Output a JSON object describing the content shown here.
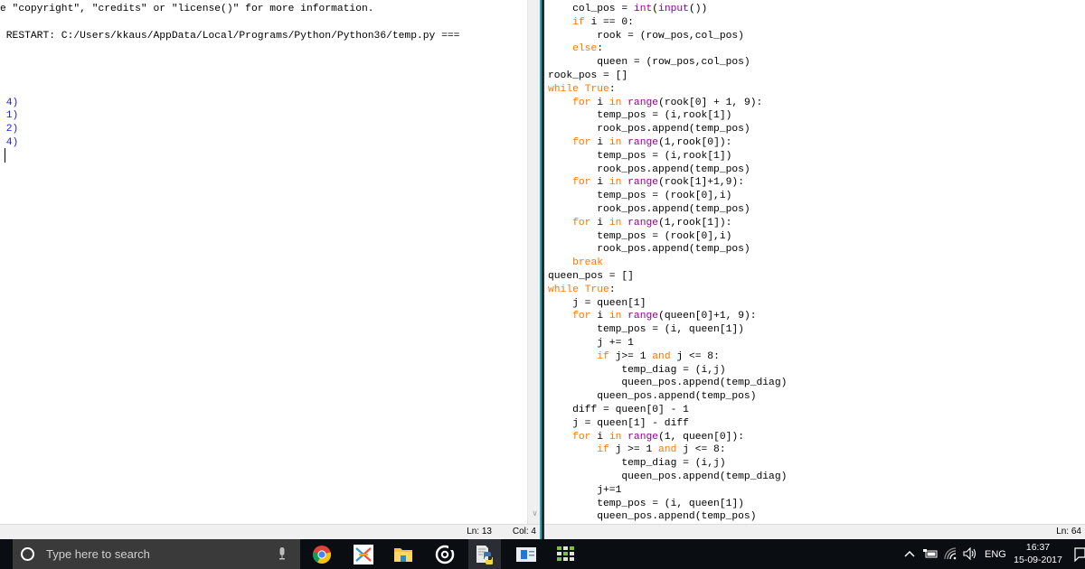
{
  "shell": {
    "lines": [
      {
        "text": "e \"copyright\", \"credits\" or \"license()\" for more information.",
        "type": "normal"
      },
      {
        "text": "",
        "type": "normal"
      },
      {
        "text": " RESTART: C:/Users/kkaus/AppData/Local/Programs/Python/Python36/temp.py ===",
        "type": "normal"
      },
      {
        "text": "",
        "type": "normal"
      },
      {
        "text": "",
        "type": "normal"
      },
      {
        "text": "",
        "type": "normal"
      },
      {
        "text": "",
        "type": "normal"
      },
      {
        "text": " 4)",
        "type": "out"
      },
      {
        "text": " 1)",
        "type": "out"
      },
      {
        "text": " 2)",
        "type": "out"
      },
      {
        "text": " 4)",
        "type": "out"
      }
    ],
    "status": {
      "ln": "Ln: 13",
      "col": "Col: 4"
    }
  },
  "editor": {
    "lines": [
      [
        [
          "    col_pos = ",
          ""
        ],
        [
          "int",
          "bi"
        ],
        [
          "(",
          ""
        ],
        [
          "input",
          "bi"
        ],
        [
          "())",
          ""
        ]
      ],
      [
        [
          "    ",
          ""
        ],
        [
          "if",
          "kw"
        ],
        [
          " i == 0:",
          ""
        ]
      ],
      [
        [
          "        rook = (row_pos,col_pos)",
          ""
        ]
      ],
      [
        [
          "    ",
          ""
        ],
        [
          "else",
          "kw"
        ],
        [
          ":",
          ""
        ]
      ],
      [
        [
          "        queen = (row_pos,col_pos)",
          ""
        ]
      ],
      [
        [
          "rook_pos = []",
          ""
        ]
      ],
      [
        [
          "while",
          "kw"
        ],
        [
          " ",
          ""
        ],
        [
          "True",
          "kw"
        ],
        [
          ":",
          ""
        ]
      ],
      [
        [
          "    ",
          ""
        ],
        [
          "for",
          "kw"
        ],
        [
          " i ",
          ""
        ],
        [
          "in",
          "kw"
        ],
        [
          " ",
          ""
        ],
        [
          "range",
          "bi"
        ],
        [
          "(rook[0] + 1, 9):",
          ""
        ]
      ],
      [
        [
          "        temp_pos = (i,rook[1])",
          ""
        ]
      ],
      [
        [
          "        rook_pos.append(temp_pos)",
          ""
        ]
      ],
      [
        [
          "    ",
          ""
        ],
        [
          "for",
          "kw"
        ],
        [
          " i ",
          ""
        ],
        [
          "in",
          "kw"
        ],
        [
          " ",
          ""
        ],
        [
          "range",
          "bi"
        ],
        [
          "(1,rook[0]):",
          ""
        ]
      ],
      [
        [
          "        temp_pos = (i,rook[1])",
          ""
        ]
      ],
      [
        [
          "        rook_pos.append(temp_pos)",
          ""
        ]
      ],
      [
        [
          "    ",
          ""
        ],
        [
          "for",
          "kw"
        ],
        [
          " i ",
          ""
        ],
        [
          "in",
          "kw"
        ],
        [
          " ",
          ""
        ],
        [
          "range",
          "bi"
        ],
        [
          "(rook[1]+1,9):",
          ""
        ]
      ],
      [
        [
          "        temp_pos = (rook[0],i)",
          ""
        ]
      ],
      [
        [
          "        rook_pos.append(temp_pos)",
          ""
        ]
      ],
      [
        [
          "    ",
          ""
        ],
        [
          "for",
          "kw"
        ],
        [
          " i ",
          ""
        ],
        [
          "in",
          "kw"
        ],
        [
          " ",
          ""
        ],
        [
          "range",
          "bi"
        ],
        [
          "(1,rook[1]):",
          ""
        ]
      ],
      [
        [
          "        temp_pos = (rook[0],i)",
          ""
        ]
      ],
      [
        [
          "        rook_pos.append(temp_pos)",
          ""
        ]
      ],
      [
        [
          "    ",
          ""
        ],
        [
          "break",
          "kw"
        ]
      ],
      [
        [
          "queen_pos = []",
          ""
        ]
      ],
      [
        [
          "while",
          "kw"
        ],
        [
          " ",
          ""
        ],
        [
          "True",
          "kw"
        ],
        [
          ":",
          ""
        ]
      ],
      [
        [
          "    j = queen[1]",
          ""
        ]
      ],
      [
        [
          "    ",
          ""
        ],
        [
          "for",
          "kw"
        ],
        [
          " i ",
          ""
        ],
        [
          "in",
          "kw"
        ],
        [
          " ",
          ""
        ],
        [
          "range",
          "bi"
        ],
        [
          "(queen[0]+1, 9):",
          ""
        ]
      ],
      [
        [
          "        temp_pos = (i, queen[1])",
          ""
        ]
      ],
      [
        [
          "        j += 1",
          ""
        ]
      ],
      [
        [
          "        ",
          ""
        ],
        [
          "if",
          "kw"
        ],
        [
          " j>= 1 ",
          ""
        ],
        [
          "and",
          "kw"
        ],
        [
          " j <= 8:",
          ""
        ]
      ],
      [
        [
          "            temp_diag = (i,j)",
          ""
        ]
      ],
      [
        [
          "            queen_pos.append(temp_diag)",
          ""
        ]
      ],
      [
        [
          "        queen_pos.append(temp_pos)",
          ""
        ]
      ],
      [
        [
          "    diff = queen[0] - 1",
          ""
        ]
      ],
      [
        [
          "    j = queen[1] - diff",
          ""
        ]
      ],
      [
        [
          "    ",
          ""
        ],
        [
          "for",
          "kw"
        ],
        [
          " i ",
          ""
        ],
        [
          "in",
          "kw"
        ],
        [
          " ",
          ""
        ],
        [
          "range",
          "bi"
        ],
        [
          "(1, queen[0]):",
          ""
        ]
      ],
      [
        [
          "        ",
          ""
        ],
        [
          "if",
          "kw"
        ],
        [
          " j >= 1 ",
          ""
        ],
        [
          "and",
          "kw"
        ],
        [
          " j <= 8:",
          ""
        ]
      ],
      [
        [
          "            temp_diag = (i,j)",
          ""
        ]
      ],
      [
        [
          "            queen_pos.append(temp_diag)",
          ""
        ]
      ],
      [
        [
          "        j+=1",
          ""
        ]
      ],
      [
        [
          "        temp_pos = (i, queen[1])",
          ""
        ]
      ],
      [
        [
          "        queen_pos.append(temp_pos)",
          ""
        ]
      ]
    ],
    "status": {
      "ln": "Ln: 64"
    }
  },
  "taskbar": {
    "search_placeholder": "Type here to search",
    "apps": [
      {
        "name": "chrome",
        "icon": "chrome-icon"
      },
      {
        "name": "xmind",
        "icon": "xmind-icon"
      },
      {
        "name": "file-explorer",
        "icon": "folder-icon"
      },
      {
        "name": "groove",
        "icon": "groove-icon"
      },
      {
        "name": "python-idle",
        "icon": "python-icon",
        "active": true
      },
      {
        "name": "window-app",
        "icon": "window-icon"
      },
      {
        "name": "grid-app",
        "icon": "grid-icon"
      }
    ],
    "tray": {
      "language": "ENG",
      "time": "16:37",
      "date": "15-09-2017"
    }
  }
}
